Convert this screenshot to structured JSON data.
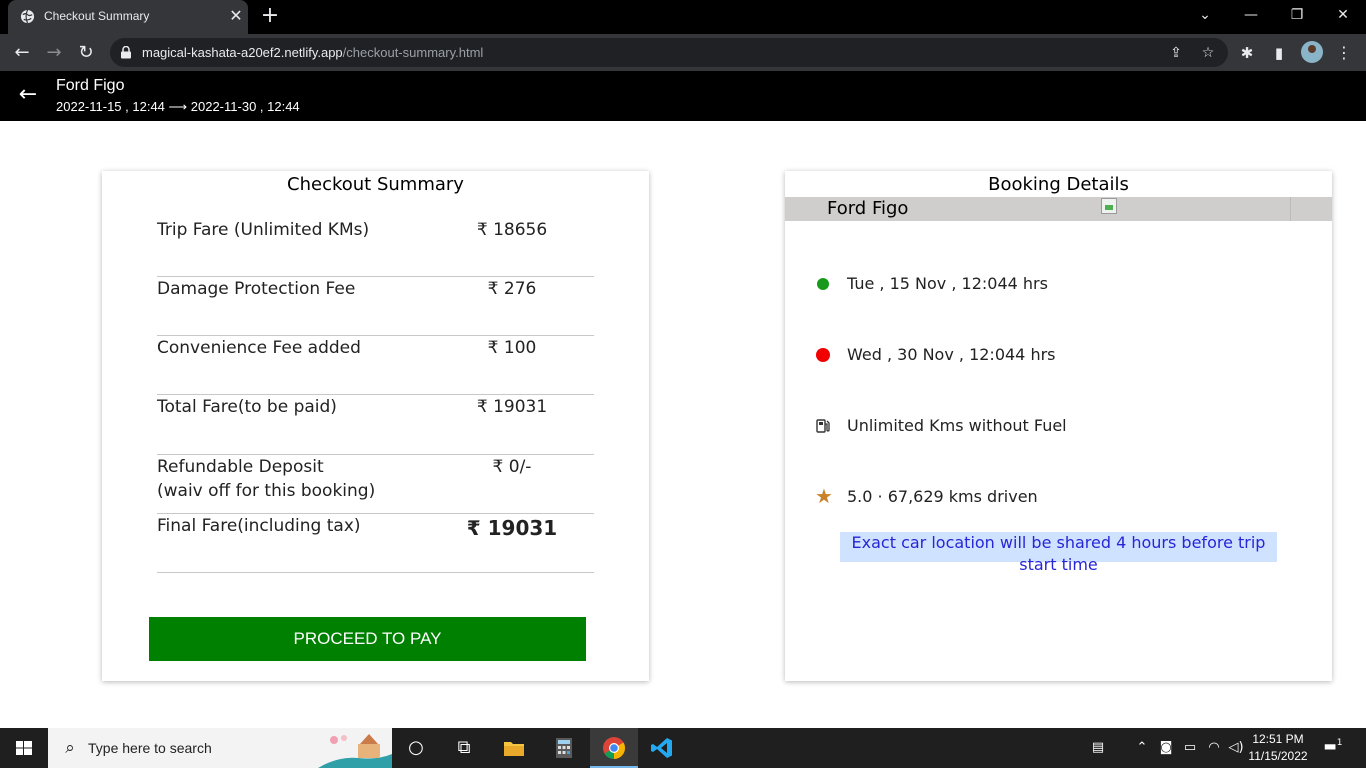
{
  "browser": {
    "tab_title": "Checkout Summary",
    "url_host": "magical-kashata-a20ef2.netlify.app",
    "url_path": "/checkout-summary.html"
  },
  "header": {
    "car_name": "Ford Figo",
    "trip_dates": "2022-11-15 , 12:44 ⟶ 2022-11-30 , 12:44"
  },
  "checkout": {
    "title": "Checkout Summary",
    "rows": [
      {
        "label": "Trip Fare (Unlimited KMs)",
        "value": "₹ 18656"
      },
      {
        "label": "Damage Protection Fee",
        "value": "₹ 276"
      },
      {
        "label": "Convenience Fee added",
        "value": "₹ 100"
      },
      {
        "label": "Total Fare(to be paid)",
        "value": "₹ 19031"
      },
      {
        "label_line1": "Refundable Deposit",
        "label_line2": "(waiv off for this booking)",
        "value": "₹ 0/-"
      },
      {
        "label": "Final Fare(including tax)",
        "value": "₹ 19031"
      }
    ],
    "pay_button": "PROCEED TO PAY"
  },
  "booking": {
    "title": "Booking Details",
    "car_name": "Ford Figo",
    "start": "Tue , 15 Nov , 12:044 hrs",
    "end": "Wed , 30 Nov , 12:044 hrs",
    "fuel": "Unlimited Kms without Fuel",
    "rating": "5.0 · 67,629 kms driven",
    "notice": "Exact car location will be shared 4 hours before trip start time"
  },
  "taskbar": {
    "search_placeholder": "Type here to search",
    "time": "12:51 PM",
    "date": "11/15/2022",
    "notification_count": "1"
  },
  "colors": {
    "pay_button": "#008000",
    "start_dot": "#1a9a1a",
    "end_dot": "#f20000",
    "star": "#c9822a",
    "notice_bg": "#cfe2ff",
    "notice_text": "#2626d6"
  }
}
